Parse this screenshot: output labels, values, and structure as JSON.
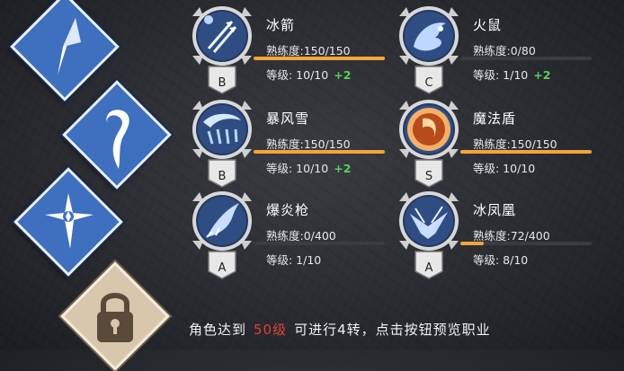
{
  "left_tabs": [
    {
      "icon": "diamond-crystal-icon",
      "locked": false
    },
    {
      "icon": "swirl-staff-icon",
      "locked": false
    },
    {
      "icon": "star-crest-icon",
      "locked": false
    },
    {
      "icon": "padlock-icon",
      "locked": true
    }
  ],
  "skills": [
    {
      "name": "冰箭",
      "rank": "B",
      "icon": "ice-arrows-icon",
      "prof_label": "熟练度:150/150",
      "progress": 1.0,
      "level_label": "等级: 10/10",
      "bonus": "+2"
    },
    {
      "name": "火鼠",
      "rank": "C",
      "icon": "fire-rat-icon",
      "prof_label": "熟练度:0/80",
      "progress": 0.0,
      "level_label": "等级: 1/10",
      "bonus": "+2"
    },
    {
      "name": "暴风雪",
      "rank": "B",
      "icon": "blizzard-icon",
      "prof_label": "熟练度:150/150",
      "progress": 1.0,
      "level_label": "等级: 10/10",
      "bonus": "+2"
    },
    {
      "name": "魔法盾",
      "rank": "S",
      "icon": "magic-shield-icon",
      "prof_label": "熟练度:150/150",
      "progress": 1.0,
      "level_label": "等级: 10/10",
      "bonus": ""
    },
    {
      "name": "爆炎枪",
      "rank": "A",
      "icon": "flame-lance-icon",
      "prof_label": "熟练度:0/400",
      "progress": 0.0,
      "level_label": "等级: 1/10",
      "bonus": ""
    },
    {
      "name": "冰凤凰",
      "rank": "A",
      "icon": "ice-phoenix-icon",
      "prof_label": "熟练度:72/400",
      "progress": 0.18,
      "level_label": "等级: 8/10",
      "bonus": ""
    }
  ],
  "footer": {
    "prefix": "角色达到",
    "level": "50级",
    "suffix": "可进行4转，点击按钮预览职业"
  },
  "colors": {
    "accent_bar": "#f2a53a",
    "bonus_green": "#58d05a",
    "level_red": "#e0403a",
    "tab_blue": "#3f6fbf"
  }
}
